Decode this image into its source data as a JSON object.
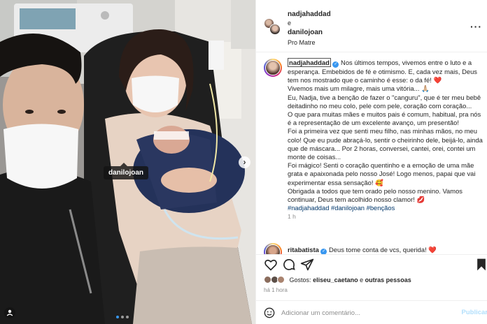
{
  "photo": {
    "tag_username": "danilojoan",
    "next_icon": "chevron-right-icon",
    "carousel": {
      "count": 3,
      "active_index": 0
    }
  },
  "header": {
    "user1": "nadjahaddad",
    "connector": "e",
    "user2": "danilojoan",
    "location": "Pro Matre",
    "more_icon": "more-horizontal-icon",
    "more_label": "···"
  },
  "caption": {
    "username": "nadjahaddad",
    "paragraphs": [
      "Nos últimos tempos, vivemos entre o luto e a esperança. Embebidos de fé e otimismo. E, cada vez mais, Deus tem nos mostrado que o caminho é esse: o da fé! ❤️",
      "Vivemos mais um milagre, mais uma vitória... 🙏🏼",
      "Eu, Nadja, tive a benção de fazer o \"canguru\", que é ter meu bebê deitadinho no meu colo, pele com pele, coração com coração...",
      "O que para muitas mães e muitos pais é comum, habitual, pra nós é a representação de um excelente avanço, um presentão!",
      "Foi a primeira vez que senti meu filho, nas minhas mãos, no meu colo! Que eu pude abraçá-lo, sentir o cheirinho dele, beijá-lo, ainda que de máscara... Por 2 horas, conversei, cantei, orei, contei um monte de coisas...",
      "Foi mágico! Senti o coração quentinho e a emoção de uma mãe grata e apaixonada pelo nosso José! Logo menos, papai que vai experimentar essa sensação! 🥰",
      "Obrigada a todos que tem orado pelo nosso menino. Vamos continuar, Deus tem acolhido nosso clamor! 💋"
    ],
    "hashtags": "#nadjahaddad #danilojoan #bençãos",
    "time": "1 h"
  },
  "comment": {
    "username": "ritabatista",
    "text": "Deus tome conta de vcs, querida! ❤️"
  },
  "actions": {
    "like_icon": "heart-icon",
    "comment_icon": "comment-icon",
    "share_icon": "share-icon",
    "save_icon": "bookmark-icon"
  },
  "likes": {
    "prefix": "Gostos:",
    "user": "eliseu_caetano",
    "suffix": "e",
    "others": "outras pessoas"
  },
  "post_time": "há 1 hora",
  "comment_bar": {
    "placeholder": "Adicionar um comentário...",
    "publish": "Publicar",
    "emoji_icon": "emoji-icon"
  },
  "colors": {
    "link": "#00376b",
    "blue": "#3897f0",
    "red": "#ed4956",
    "border": "#efefef",
    "muted": "#8e8e8e"
  }
}
